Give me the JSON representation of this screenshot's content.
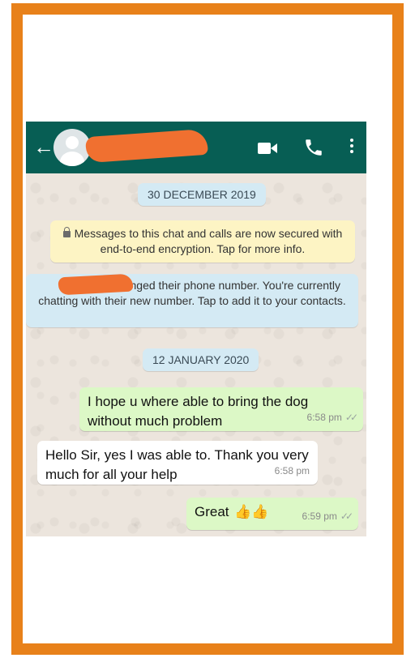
{
  "header": {
    "back_icon": "arrow-left-icon",
    "avatar": "default-avatar",
    "contact_name_redacted": true,
    "actions": [
      "video-call-icon",
      "voice-call-icon",
      "more-options-icon"
    ]
  },
  "chat": {
    "date_1": "30 DECEMBER 2019",
    "encryption_note": "Messages to this chat and calls are now secured with end-to-end encryption. Tap for more info.",
    "number_change_note": "changed their phone number. You're currently chatting with their new number. Tap to add it to your contacts.",
    "date_2": "12 JANUARY 2020",
    "messages": [
      {
        "direction": "out",
        "text": "I hope u where able to bring the dog without much problem",
        "time": "6:58 pm",
        "read": "✓✓"
      },
      {
        "direction": "in",
        "text": "Hello Sir, yes I was able to. Thank you very much for all your help",
        "time": "6:58 pm"
      },
      {
        "direction": "out",
        "text": "Great",
        "emoji": "👍👍",
        "time": "6:59 pm",
        "read": "✓✓"
      }
    ]
  },
  "colors": {
    "border": "#e8811a",
    "header": "#075e54",
    "outgoing": "#dcf8c6",
    "incoming": "#ffffff",
    "redaction": "#f07030"
  }
}
